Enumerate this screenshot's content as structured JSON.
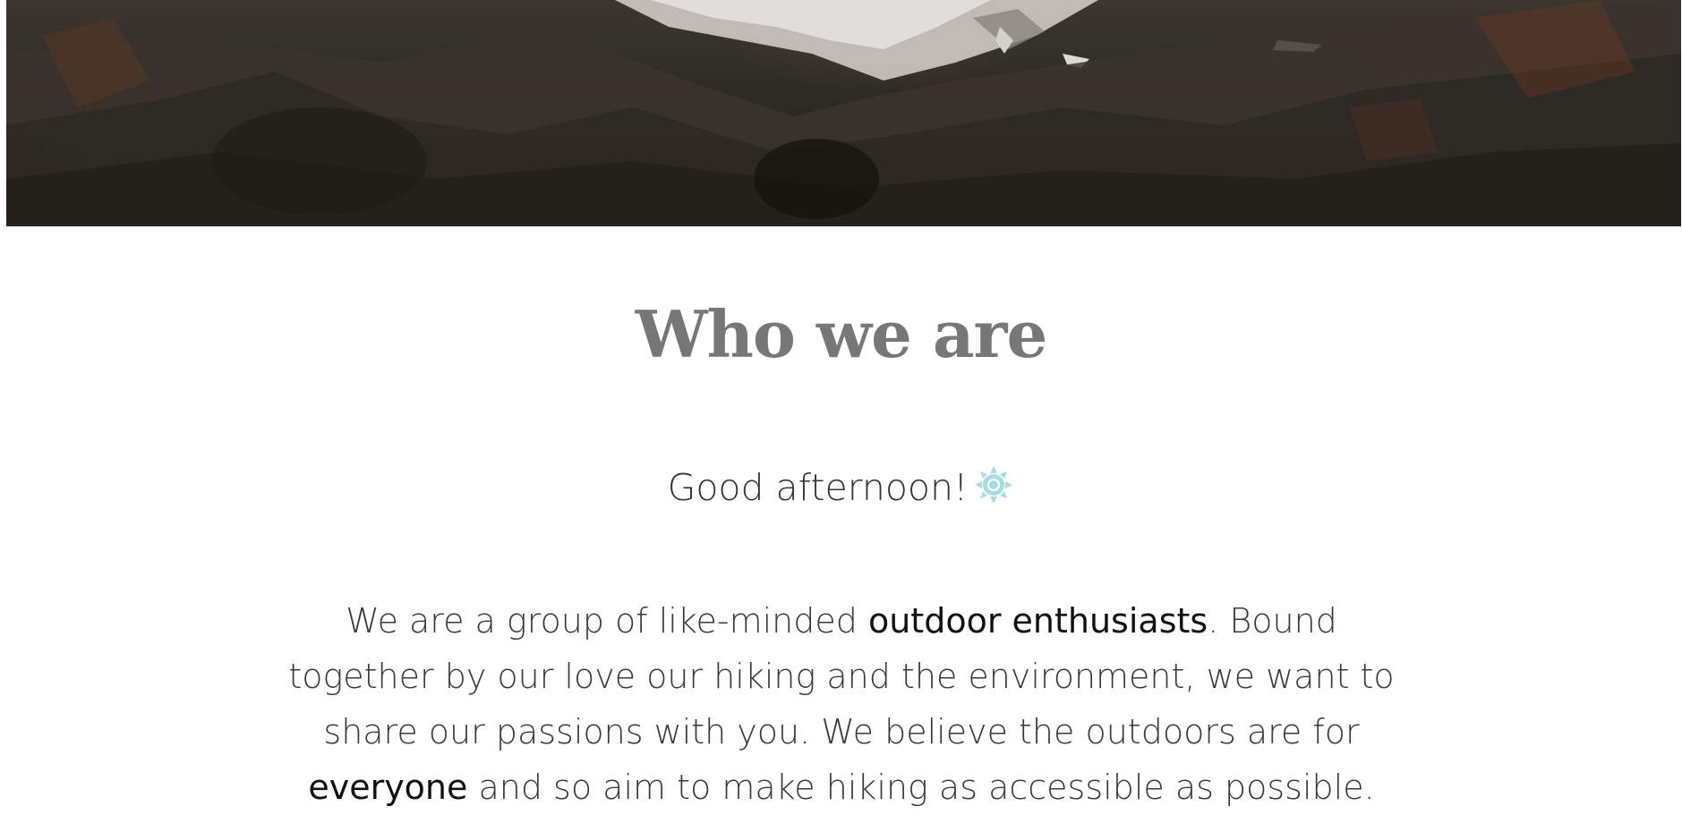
{
  "hero": {
    "image": "mountain-landscape"
  },
  "section": {
    "title": "Who we are",
    "greeting": "Good afternoon!",
    "greeting_icon": "sun-icon",
    "intro": {
      "part1": "We are a group of like-minded ",
      "highlight1": "outdoor enthusiasts",
      "part2": ". Bound together by our love our hiking and the environment, we want to share our passions with you. We believe the outdoors are for ",
      "highlight2": "everyone",
      "part3": " and so aim to make hiking as accessible as possible."
    }
  },
  "colors": {
    "title": "#777777",
    "text": "#3a3a3a",
    "highlight": "#111111",
    "sun": "#a8dde0"
  }
}
